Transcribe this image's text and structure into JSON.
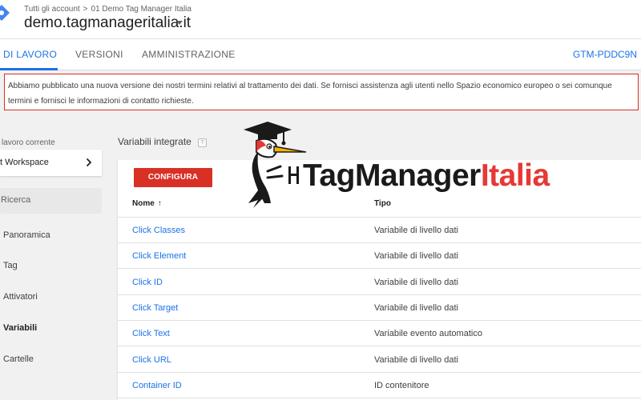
{
  "header": {
    "breadcrumb": [
      "Tutti gli account",
      "01 Demo Tag Manager Italia"
    ],
    "breadcrumb_separator": ">",
    "container_name": "demo.tagmanageritalia.it"
  },
  "tabs": [
    {
      "label": "DI LAVORO",
      "active": true
    },
    {
      "label": "VERSIONI",
      "active": false
    },
    {
      "label": "AMMINISTRAZIONE",
      "active": false
    }
  ],
  "container_id": "GTM-PDDC9N",
  "notice": {
    "text": "Abbiamo pubblicato una nuova versione dei nostri termini relativi al trattamento dei dati. Se fornisci assistenza agli utenti nello Spazio economico europeo o sei comunque termini e fornisci le informazioni di contatto richieste."
  },
  "sidebar": {
    "workspace_label": "lavoro corrente",
    "workspace_name": "t Workspace",
    "search_placeholder": "Ricerca",
    "items": [
      {
        "label": "Panoramica",
        "active": false
      },
      {
        "label": "Tag",
        "active": false
      },
      {
        "label": "Attivatori",
        "active": false
      },
      {
        "label": "Variabili",
        "active": true
      },
      {
        "label": "Cartelle",
        "active": false
      }
    ]
  },
  "main": {
    "section_title": "Variabili integrate",
    "help_glyph": "?",
    "configure_label": "CONFIGURA",
    "columns": {
      "name": "Nome",
      "sort_indicator": "↑",
      "type": "Tipo"
    },
    "rows": [
      {
        "name": "Click Classes",
        "type": "Variabile di livello dati"
      },
      {
        "name": "Click Element",
        "type": "Variabile di livello dati"
      },
      {
        "name": "Click ID",
        "type": "Variabile di livello dati"
      },
      {
        "name": "Click Target",
        "type": "Variabile di livello dati"
      },
      {
        "name": "Click Text",
        "type": "Variabile evento automatico"
      },
      {
        "name": "Click URL",
        "type": "Variabile di livello dati"
      },
      {
        "name": "Container ID",
        "type": "ID contenitore"
      }
    ]
  },
  "watermark": {
    "part_dark": "TagManager",
    "part_red": "Italia",
    "mascot_icon": "woodpecker-graduate-icon"
  },
  "colors": {
    "accent": "#1a73e8",
    "alert": "#d93025",
    "brand_red": "#e53935"
  }
}
